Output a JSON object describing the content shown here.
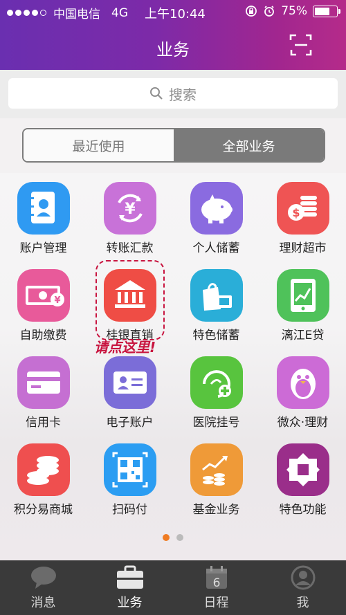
{
  "status": {
    "carrier": "中国电信",
    "network": "4G",
    "time": "上午10:44",
    "battery": "75%",
    "battery_level": 0.75
  },
  "header": {
    "title": "业务"
  },
  "search": {
    "placeholder": "搜索"
  },
  "segment": {
    "recent": "最近使用",
    "all": "全部业务"
  },
  "apps": [
    {
      "label": "账户管理",
      "icon": "account-book-icon",
      "color": "#2f9af2"
    },
    {
      "label": "转账汇款",
      "icon": "yuan-transfer-icon",
      "color": "#c872d8"
    },
    {
      "label": "个人储蓄",
      "icon": "piggy-bank-icon",
      "color": "#8a6be0"
    },
    {
      "label": "理财超市",
      "icon": "coins-stack-icon",
      "color": "#ef5454"
    },
    {
      "label": "自助缴费",
      "icon": "cash-payment-icon",
      "color": "#e85a9a"
    },
    {
      "label": "桂银直销",
      "icon": "bank-building-icon",
      "color": "#ef4d45"
    },
    {
      "label": "特色储蓄",
      "icon": "shopping-bag-icon",
      "color": "#2aaed8"
    },
    {
      "label": "漓江E贷",
      "icon": "tablet-chart-icon",
      "color": "#4fc25a"
    },
    {
      "label": "信用卡",
      "icon": "credit-card-icon",
      "color": "#c56fd2"
    },
    {
      "label": "电子账户",
      "icon": "id-card-icon",
      "color": "#7b6dd8"
    },
    {
      "label": "医院挂号",
      "icon": "hospital-swirl-icon",
      "color": "#58c43e"
    },
    {
      "label": "微众·理财",
      "icon": "penguin-icon",
      "color": "#cc6bd6"
    },
    {
      "label": "积分易商城",
      "icon": "points-coins-icon",
      "color": "#ef4f4f"
    },
    {
      "label": "扫码付",
      "icon": "qr-code-icon",
      "color": "#2b9df2"
    },
    {
      "label": "基金业务",
      "icon": "fund-chart-icon",
      "color": "#ef9a38"
    },
    {
      "label": "特色功能",
      "icon": "special-square-icon",
      "color": "#9a2e8a"
    }
  ],
  "hint": "请点这里!",
  "tabs": [
    {
      "label": "消息",
      "icon": "message-bubble-icon"
    },
    {
      "label": "业务",
      "icon": "briefcase-icon"
    },
    {
      "label": "日程",
      "icon": "calendar-icon",
      "day": "6"
    },
    {
      "label": "我",
      "icon": "user-avatar-icon"
    }
  ]
}
